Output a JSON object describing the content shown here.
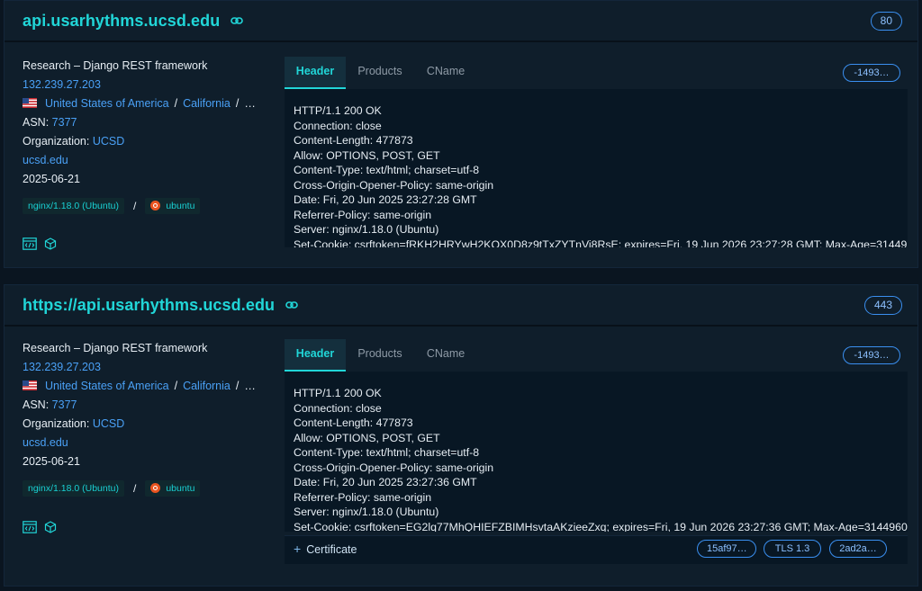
{
  "records": [
    {
      "host": "api.usarhythms.ucsd.edu",
      "port": "80",
      "title": "Research – Django REST framework",
      "ip": "132.239.27.203",
      "country": "United States of America",
      "region": "California",
      "region_more": "…",
      "asn_label": "ASN:",
      "asn": "7377",
      "org_label": "Organization:",
      "org": "UCSD",
      "domain": "ucsd.edu",
      "date": "2025-06-21",
      "server_tag": "nginx/1.18.0 (Ubuntu)",
      "os_tag": "ubuntu",
      "tabs": [
        "Header",
        "Products",
        "CName"
      ],
      "hash_pill": "-1493…",
      "headers": "HTTP/1.1 200 OK\nConnection: close\nContent-Length: 477873\nAllow: OPTIONS, POST, GET\nContent-Type: text/html; charset=utf-8\nCross-Origin-Opener-Policy: same-origin\nDate: Fri, 20 Jun 2025 23:27:28 GMT\nReferrer-Policy: same-origin\nServer: nginx/1.18.0 (Ubuntu)\nSet-Cookie: csrftoken=fRKH2HRYwH2KQX0D8z9tTxZYTnVi8RsE; expires=Fri, 19 Jun 2026 23:27:28 GMT; Max-Age=31449"
    },
    {
      "host": "https://api.usarhythms.ucsd.edu",
      "port": "443",
      "title": "Research – Django REST framework",
      "ip": "132.239.27.203",
      "country": "United States of America",
      "region": "California",
      "region_more": "…",
      "asn_label": "ASN:",
      "asn": "7377",
      "org_label": "Organization:",
      "org": "UCSD",
      "domain": "ucsd.edu",
      "date": "2025-06-21",
      "server_tag": "nginx/1.18.0 (Ubuntu)",
      "os_tag": "ubuntu",
      "tabs": [
        "Header",
        "Products",
        "CName"
      ],
      "hash_pill": "-1493…",
      "headers": "HTTP/1.1 200 OK\nConnection: close\nContent-Length: 477873\nAllow: OPTIONS, POST, GET\nContent-Type: text/html; charset=utf-8\nCross-Origin-Opener-Policy: same-origin\nDate: Fri, 20 Jun 2025 23:27:36 GMT\nReferrer-Policy: same-origin\nServer: nginx/1.18.0 (Ubuntu)\nSet-Cookie: csrftoken=EG2lq77MhQHIEFZBIMHsvtaAKzieeZxq; expires=Fri, 19 Jun 2026 23:27:36 GMT; Max-Age=3144960",
      "certificate_label": "Certificate",
      "cert_pills": [
        "15af97…",
        "TLS 1.3",
        "2ad2a…"
      ]
    }
  ],
  "colors": {
    "accent": "#21d6d8",
    "link": "#4aa0f5",
    "pill_border": "#3a8ff0",
    "background": "#0a1520"
  }
}
